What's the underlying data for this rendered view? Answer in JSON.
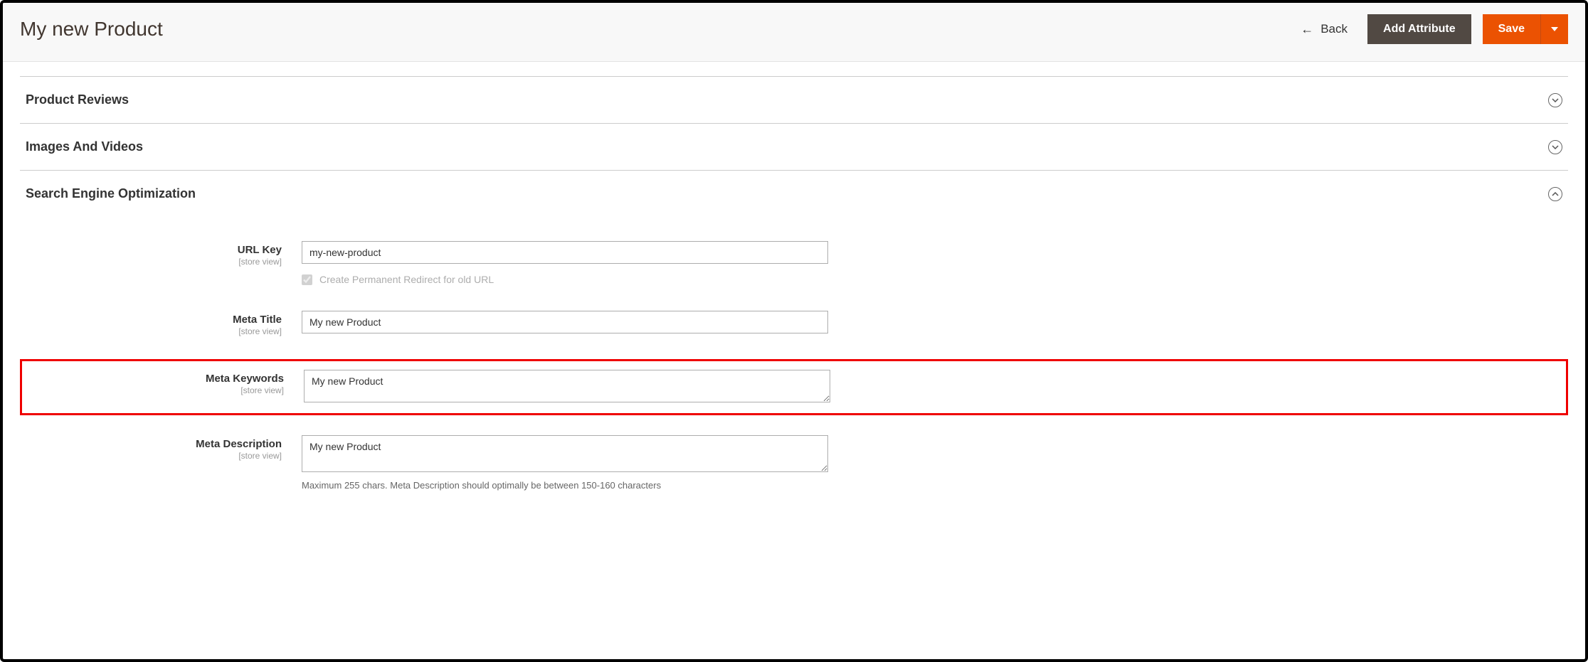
{
  "header": {
    "title": "My new Product",
    "back_label": "Back",
    "add_attribute_label": "Add Attribute",
    "save_label": "Save"
  },
  "sections": {
    "product_reviews": {
      "title": "Product Reviews"
    },
    "images_videos": {
      "title": "Images And Videos"
    },
    "seo": {
      "title": "Search Engine Optimization"
    }
  },
  "seo_form": {
    "url_key": {
      "label": "URL Key",
      "scope": "[store view]",
      "value": "my-new-product",
      "redirect_label": "Create Permanent Redirect for old URL",
      "redirect_checked": true
    },
    "meta_title": {
      "label": "Meta Title",
      "scope": "[store view]",
      "value": "My new Product"
    },
    "meta_keywords": {
      "label": "Meta Keywords",
      "scope": "[store view]",
      "value": "My new Product"
    },
    "meta_description": {
      "label": "Meta Description",
      "scope": "[store view]",
      "value": "My new Product",
      "hint": "Maximum 255 chars. Meta Description should optimally be between 150-160 characters"
    }
  }
}
